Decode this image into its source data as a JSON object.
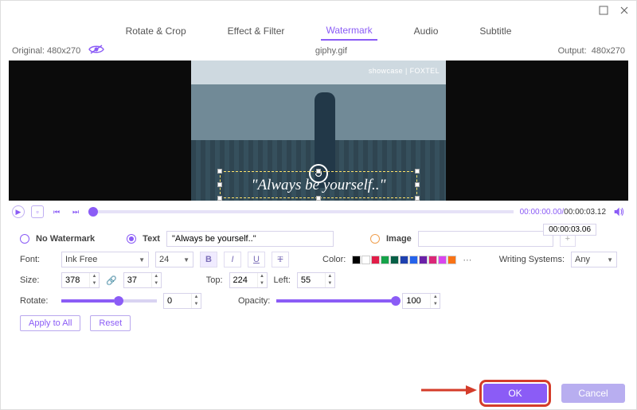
{
  "titlebar": {},
  "tabs": [
    {
      "id": "rotate",
      "label": "Rotate & Crop",
      "active": false
    },
    {
      "id": "effect",
      "label": "Effect & Filter",
      "active": false
    },
    {
      "id": "watermark",
      "label": "Watermark",
      "active": true
    },
    {
      "id": "audio",
      "label": "Audio",
      "active": false
    },
    {
      "id": "subtitle",
      "label": "Subtitle",
      "active": false
    }
  ],
  "info": {
    "original_label": "Original:",
    "original_value": "480x270",
    "filename": "giphy.gif",
    "output_label": "Output:",
    "output_value": "480x270"
  },
  "preview": {
    "badge": "showcase | FOXTEL",
    "watermark_text": "\"Always be yourself..\""
  },
  "playbar": {
    "current": "00:00:00.00",
    "sep": "/",
    "total": "00:00:03.12",
    "tooltip_time": "00:00:03.06"
  },
  "wm": {
    "none_label": "No Watermark",
    "text_label": "Text",
    "text_value": "\"Always be yourself..\"",
    "image_label": "Image"
  },
  "font_row": {
    "font_label": "Font:",
    "font_value": "Ink Free",
    "size_value": "24",
    "color_label": "Color:",
    "writing_label": "Writing Systems:",
    "writing_value": "Any"
  },
  "swatches": [
    "#000000",
    "#ffffff",
    "#e11d48",
    "#16a34a",
    "#065f46",
    "#1e40af",
    "#2563eb",
    "#6b21a8",
    "#db2777",
    "#d946ef",
    "#f97316"
  ],
  "size_row": {
    "size_label": "Size:",
    "w": "378",
    "h": "37",
    "top_label": "Top:",
    "top": "224",
    "left_label": "Left:",
    "left": "55"
  },
  "rotate_row": {
    "rotate_label": "Rotate:",
    "rotate_val": "0",
    "opacity_label": "Opacity:",
    "opacity_val": "100"
  },
  "btns": {
    "apply_all": "Apply to All",
    "reset": "Reset"
  },
  "footer": {
    "ok": "OK",
    "cancel": "Cancel"
  }
}
